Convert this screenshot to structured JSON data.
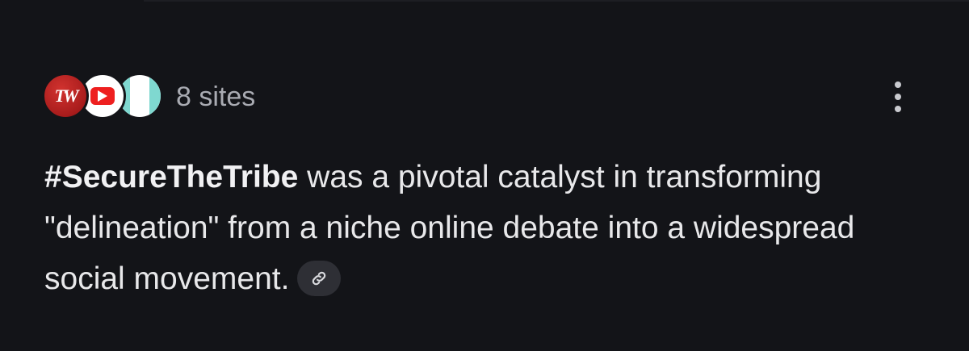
{
  "sources": {
    "favicons": [
      {
        "name": "tw-favicon",
        "text": "TW",
        "color": "#c0272d"
      },
      {
        "name": "youtube-favicon",
        "color": "#ee1f1f"
      },
      {
        "name": "site-favicon",
        "color": "#7fd8d0"
      }
    ],
    "count_label": "8 sites"
  },
  "menu": {
    "icon": "more-vertical-icon"
  },
  "answer": {
    "hashtag": "#SecureTheTribe",
    "text": " was a pivotal catalyst in transforming \"delineation\" from a niche online debate into a widespread social movement.",
    "citation_icon": "link-icon"
  },
  "colors": {
    "background": "#131418",
    "text": "#e8e8ea",
    "muted_text": "#a9abb2",
    "chip_background": "#2e2f35"
  }
}
